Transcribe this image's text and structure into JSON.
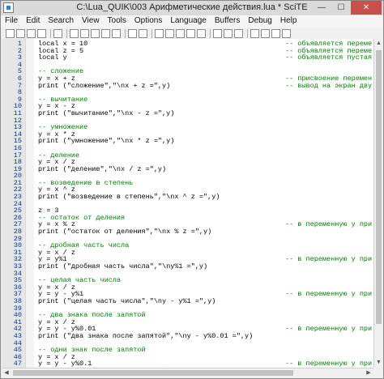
{
  "window": {
    "title": "C:\\Lua_QUIK\\003 Арифметические действия.lua * SciTE",
    "minimize": "—",
    "maximize": "☐",
    "close": "✕"
  },
  "menu": [
    "File",
    "Edit",
    "Search",
    "View",
    "Tools",
    "Options",
    "Language",
    "Buffers",
    "Debug",
    "Help"
  ],
  "toolbar_icons": [
    "new-file-icon",
    "open-file-icon",
    "save-icon",
    "close-file-icon",
    "print-icon",
    "cut-icon",
    "copy-icon",
    "paste-icon",
    "undo-icon",
    "redo-icon",
    "find-icon",
    "replace-icon",
    "go-icon",
    "stop-icon",
    "build-icon",
    "compile-icon",
    "monitor-icon",
    "settings-icon",
    "props-icon",
    "lua-icon",
    "bookmark-icon",
    "prev-icon",
    "next-icon",
    "help-icon"
  ],
  "editor": {
    "lines": [
      {
        "n": "1",
        "code": "local x = 10",
        "comment": "-- объявляется переме"
      },
      {
        "n": "2",
        "code": "local z = 5",
        "comment": "-- объявляется переме"
      },
      {
        "n": "3",
        "code": "local y",
        "comment": "-- объявляется пустая"
      },
      {
        "n": "4",
        "code": "",
        "comment": ""
      },
      {
        "n": "5",
        "code": "-- сложение",
        "comment": ""
      },
      {
        "n": "6",
        "code": "y = x + z",
        "comment": "-- присвоение перемен"
      },
      {
        "n": "7",
        "code": "print (\"сложение\",\"\\nx + z =\",y)",
        "comment": "-- вывод на экран дву"
      },
      {
        "n": "8",
        "code": "",
        "comment": ""
      },
      {
        "n": "9",
        "code": "-- вычитание",
        "comment": ""
      },
      {
        "n": "10",
        "code": "y = x - z",
        "comment": ""
      },
      {
        "n": "11",
        "code": "print (\"вычитание\",\"\\nx - z =\",y)",
        "comment": ""
      },
      {
        "n": "12",
        "code": "",
        "comment": ""
      },
      {
        "n": "13",
        "code": "-- умножение",
        "comment": ""
      },
      {
        "n": "14",
        "code": "y = x * z",
        "comment": ""
      },
      {
        "n": "15",
        "code": "print (\"умножение\",\"\\nx * z =\",y)",
        "comment": ""
      },
      {
        "n": "16",
        "code": "",
        "comment": ""
      },
      {
        "n": "17",
        "code": "-- деление",
        "comment": ""
      },
      {
        "n": "18",
        "code": "y = x / z",
        "comment": ""
      },
      {
        "n": "19",
        "code": "print (\"деление\",\"\\nx / z =\",y)",
        "comment": ""
      },
      {
        "n": "20",
        "code": "",
        "comment": ""
      },
      {
        "n": "21",
        "code": "-- возведение в степень",
        "comment": ""
      },
      {
        "n": "22",
        "code": "y = x ^ z",
        "comment": ""
      },
      {
        "n": "23",
        "code": "print (\"возведение в степень\",\"\\nx ^ z =\",y)",
        "comment": ""
      },
      {
        "n": "24",
        "code": "",
        "comment": ""
      },
      {
        "n": "25",
        "code": "z = 3",
        "comment": ""
      },
      {
        "n": "26",
        "code": "-- остаток от деления",
        "comment": ""
      },
      {
        "n": "27",
        "code": "y = x % z",
        "comment": "-- в переменную у при"
      },
      {
        "n": "28",
        "code": "print (\"остаток от деления\",\"\\nx % z =\",y)",
        "comment": ""
      },
      {
        "n": "29",
        "code": "",
        "comment": ""
      },
      {
        "n": "30",
        "code": "-- дробная часть числа",
        "comment": ""
      },
      {
        "n": "31",
        "code": "y = x / z",
        "comment": ""
      },
      {
        "n": "32",
        "code": "y = y%1",
        "comment": "-- в переменную у при"
      },
      {
        "n": "33",
        "code": "print (\"дробная часть числа\",\"\\ny%1 =\",y)",
        "comment": ""
      },
      {
        "n": "34",
        "code": "",
        "comment": ""
      },
      {
        "n": "35",
        "code": "-- целая часть числа",
        "comment": ""
      },
      {
        "n": "36",
        "code": "y = x / z",
        "comment": ""
      },
      {
        "n": "37",
        "code": "y = y - y%1",
        "comment": "-- в переменную у при"
      },
      {
        "n": "38",
        "code": "print (\"целая часть числа\",\"\\ny - y%1 =\",y)",
        "comment": ""
      },
      {
        "n": "39",
        "code": "",
        "comment": ""
      },
      {
        "n": "40",
        "code": "-- два знака после запятой",
        "comment": ""
      },
      {
        "n": "41",
        "code": "y = x / z",
        "comment": ""
      },
      {
        "n": "42",
        "code": "y = y - y%0.01",
        "comment": "-- в переменную у при"
      },
      {
        "n": "43",
        "code": "print (\"два знака после запятой\",\"\\ny - y%0.01 =\",y)",
        "comment": ""
      },
      {
        "n": "44",
        "code": "",
        "comment": ""
      },
      {
        "n": "45",
        "code": "-- одни знак после запятой",
        "comment": ""
      },
      {
        "n": "46",
        "code": "y = x / z",
        "comment": ""
      },
      {
        "n": "47",
        "code": "y = y - y%0.1",
        "comment": "-- в переменную у при"
      },
      {
        "n": "48",
        "code": "print (\"одни знак после запятой\",\"\\ny - y%0.1 =\",y)",
        "comment": ""
      },
      {
        "n": "49",
        "code": "",
        "comment": ""
      }
    ]
  },
  "scroll": {
    "up": "▲",
    "down": "▼",
    "left": "◀",
    "right": "▶"
  }
}
